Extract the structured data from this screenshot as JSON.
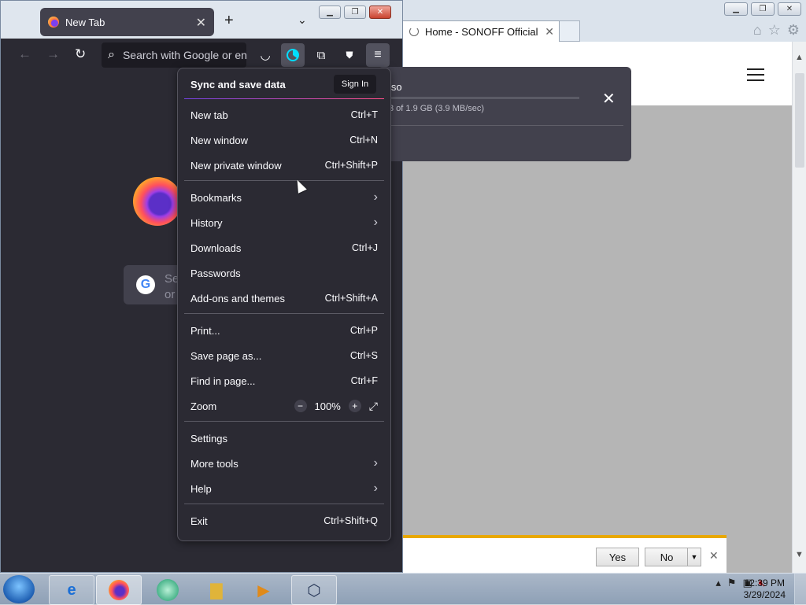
{
  "ie": {
    "tab_title": "Home - SONOFF Official",
    "notification": {
      "yes_label": "Yes",
      "no_label": "No"
    }
  },
  "firefox": {
    "tab_title": "New Tab",
    "url_placeholder": "Search with Google or enter address",
    "search_box_text": "Se\nor"
  },
  "download_panel": {
    "filename_fragment": "iso",
    "status_fragment": "3 of 1.9 GB (3.9 MB/sec)"
  },
  "app_menu": {
    "sync_label": "Sync and save data",
    "sign_in_label": "Sign In",
    "items": [
      {
        "label": "New tab",
        "shortcut": "Ctrl+T"
      },
      {
        "label": "New window",
        "shortcut": "Ctrl+N"
      },
      {
        "label": "New private window",
        "shortcut": "Ctrl+Shift+P"
      },
      {
        "label": "Bookmarks",
        "shortcut": ""
      },
      {
        "label": "History",
        "shortcut": ""
      },
      {
        "label": "Downloads",
        "shortcut": "Ctrl+J"
      },
      {
        "label": "Passwords",
        "shortcut": ""
      },
      {
        "label": "Add-ons and themes",
        "shortcut": "Ctrl+Shift+A"
      },
      {
        "label": "Print...",
        "shortcut": "Ctrl+P"
      },
      {
        "label": "Save page as...",
        "shortcut": "Ctrl+S"
      },
      {
        "label": "Find in page...",
        "shortcut": "Ctrl+F"
      },
      {
        "label": "Zoom",
        "shortcut": ""
      },
      {
        "label": "Settings",
        "shortcut": ""
      },
      {
        "label": "More tools",
        "shortcut": ""
      },
      {
        "label": "Help",
        "shortcut": ""
      },
      {
        "label": "Exit",
        "shortcut": "Ctrl+Shift+Q"
      }
    ],
    "zoom_level": "100%"
  },
  "taskbar": {
    "time": "12:39 PM",
    "date": "3/29/2024"
  }
}
